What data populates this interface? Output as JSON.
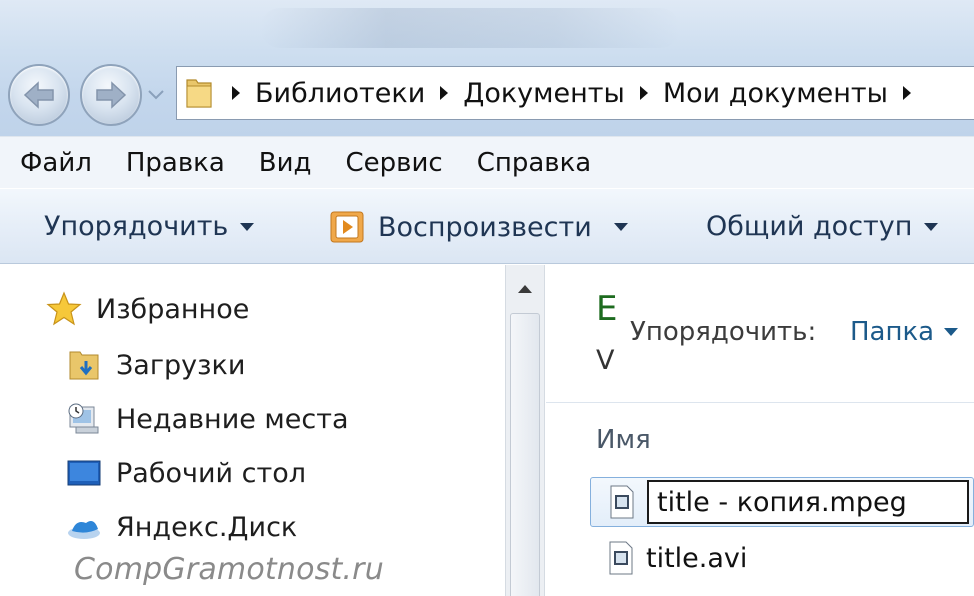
{
  "address_bar": {
    "crumbs": [
      "Библиотеки",
      "Документы",
      "Мои документы"
    ]
  },
  "menu": [
    "Файл",
    "Правка",
    "Вид",
    "Сервис",
    "Справка"
  ],
  "command_bar": {
    "organize": "Упорядочить",
    "play": "Воспроизвести",
    "share": "Общий доступ"
  },
  "nav_pane": {
    "favorites_header": "Избранное",
    "items": [
      {
        "label": "Загрузки",
        "icon": "downloads-folder-icon"
      },
      {
        "label": "Недавние места",
        "icon": "recent-places-icon"
      },
      {
        "label": "Рабочий стол",
        "icon": "desktop-icon"
      },
      {
        "label": "Яндекс.Диск",
        "icon": "yandex-disk-icon"
      }
    ]
  },
  "content": {
    "library_title_partial": "Е",
    "library_subtitle_partial": "V",
    "arrange_by_label": "Упорядочить:",
    "arrange_by_value": "Папка",
    "column_name": "Имя",
    "files": [
      {
        "name": "title - копия.mpeg",
        "renaming": true
      },
      {
        "name": "title.avi",
        "renaming": false
      }
    ]
  },
  "watermark": "CompGramotnost.ru",
  "colors": {
    "accent_link": "#1c5a8a",
    "library_title": "#1d6b1f",
    "selection_border": "#85b0dd"
  }
}
